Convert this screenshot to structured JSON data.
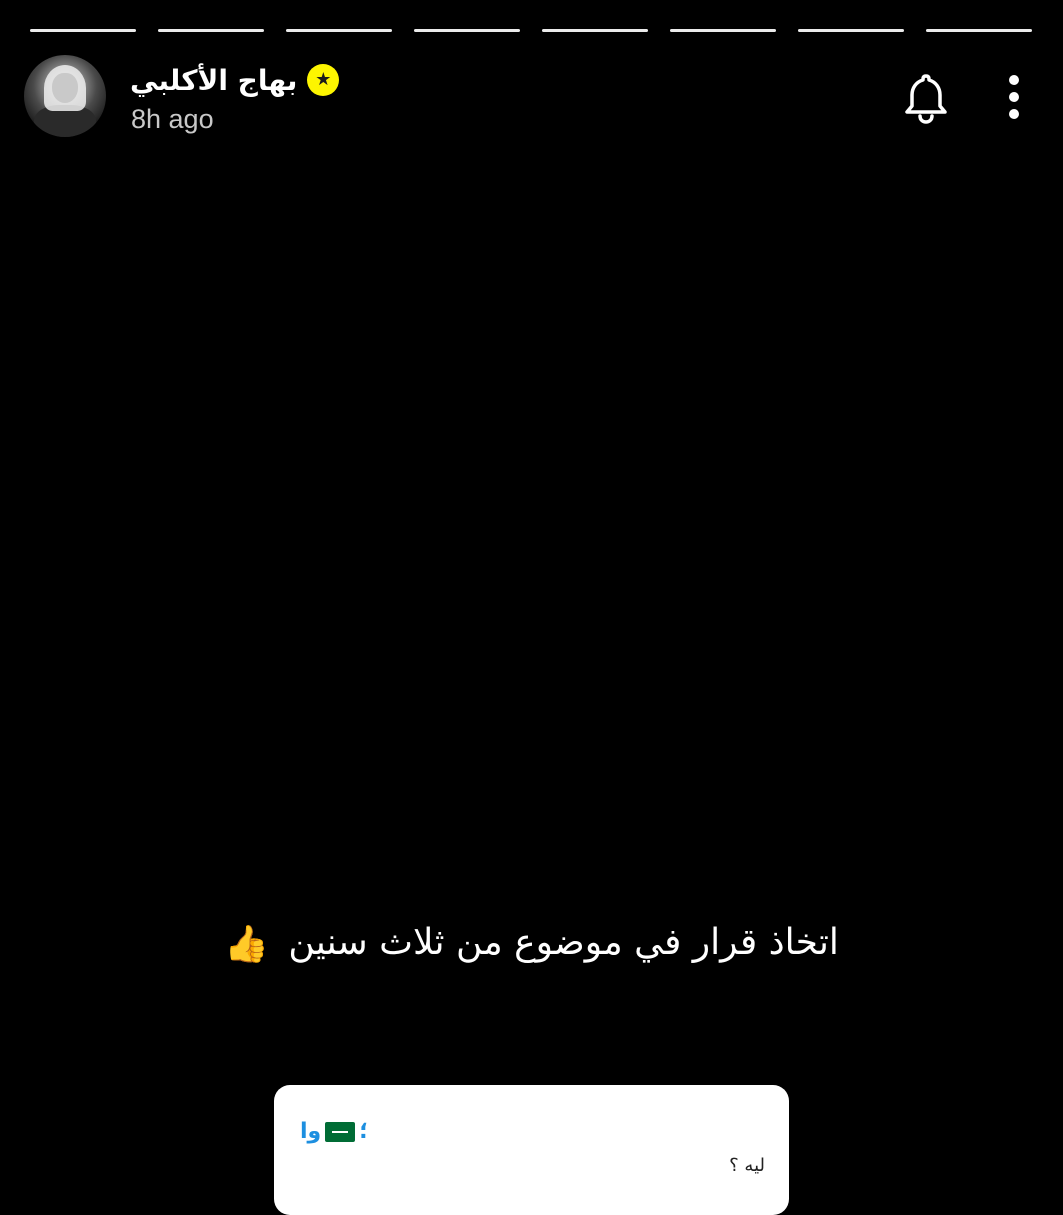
{
  "story": {
    "progress_segments": 8,
    "progress_color": "#ffffff"
  },
  "header": {
    "username": "بهاج الأكلبي",
    "time_ago": "8h ago",
    "badge_color": "#fdf500",
    "icons": {
      "avatar": "profile-avatar",
      "badge": "star-badge-icon",
      "notify": "bell-icon",
      "more": "more-vertical-icon"
    }
  },
  "caption": {
    "text": "اتخاذ قرار في موضوع  من ثلاث سنين",
    "emoji": "👍"
  },
  "reply": {
    "sender": "وا",
    "sender_suffix": "؛",
    "sender_color": "#1d8fe0",
    "message": "ليه ؟",
    "flag_icon": "saudi-flag-icon"
  }
}
